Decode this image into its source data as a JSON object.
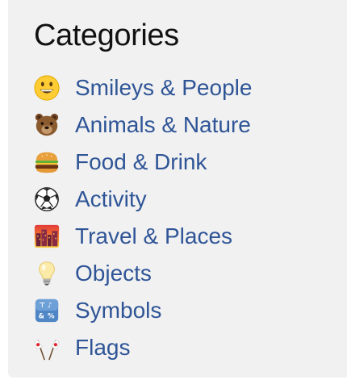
{
  "title": "Categories",
  "link_color": "#2f5597",
  "categories": [
    {
      "label": "Smileys & People",
      "icon": "grinning-face-icon"
    },
    {
      "label": "Animals & Nature",
      "icon": "bear-face-icon"
    },
    {
      "label": "Food & Drink",
      "icon": "hamburger-icon"
    },
    {
      "label": "Activity",
      "icon": "soccer-ball-icon"
    },
    {
      "label": "Travel & Places",
      "icon": "city-sunset-icon"
    },
    {
      "label": "Objects",
      "icon": "light-bulb-icon"
    },
    {
      "label": "Symbols",
      "icon": "input-symbols-icon"
    },
    {
      "label": "Flags",
      "icon": "crossed-flags-icon"
    }
  ]
}
